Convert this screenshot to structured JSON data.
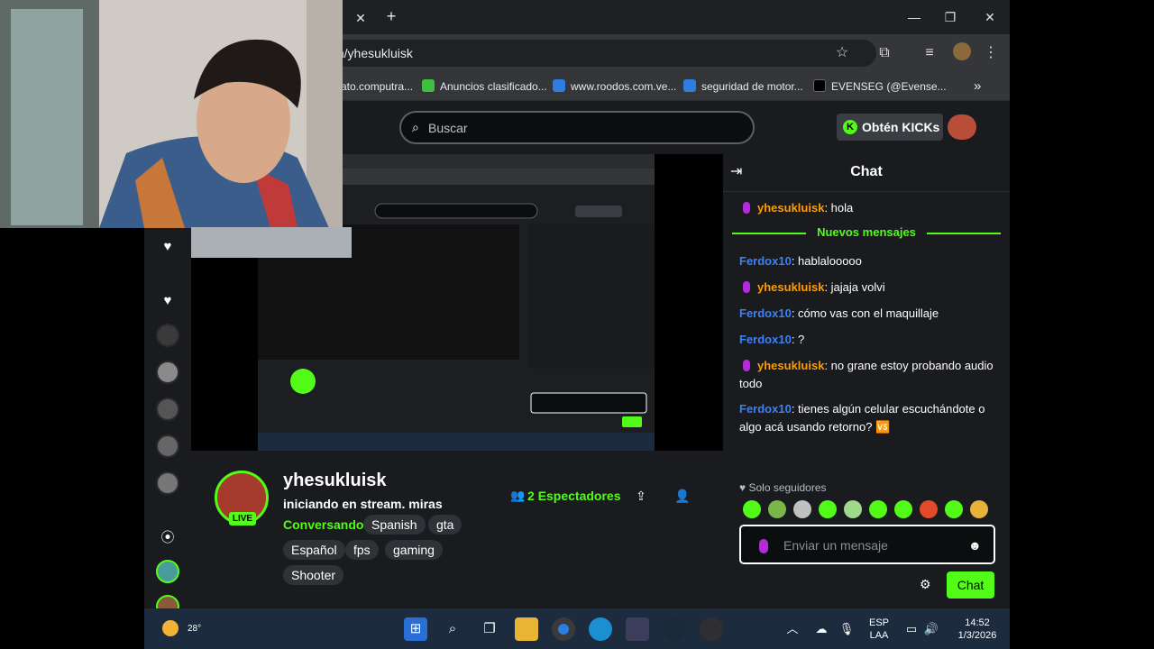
{
  "browser": {
    "url": "m/yhesukluisk",
    "bookmarks": [
      {
        "label": "ato.computra...",
        "color": "#4a4a4a"
      },
      {
        "label": "Anuncios clasificado...",
        "color": "#3fbf3f"
      },
      {
        "label": "www.roodos.com.ve...",
        "color": "#2f7de1"
      },
      {
        "label": "seguridad de motor...",
        "color": "#2f7de1"
      },
      {
        "label": "EVENSEG (@Evense...",
        "color": "#000000"
      }
    ]
  },
  "header": {
    "search_placeholder": "Buscar",
    "kicks_label": "Obtén KICKs"
  },
  "channel": {
    "name": "yhesukluisk",
    "title": "iniciando en stream. miras",
    "category": "Conversando",
    "live": "LIVE",
    "viewers_count": "2",
    "viewers_label": "Espectadores",
    "tags_row1": [
      "Spanish",
      "gta"
    ],
    "tags_row2": [
      "Español",
      "fps",
      "gaming"
    ],
    "tags_row3": [
      "Shooter"
    ]
  },
  "chat": {
    "title": "Chat",
    "new_messages": "Nuevos mensajes",
    "messages": [
      {
        "user": "yhesukluisk",
        "text": ": hola",
        "mod": true
      },
      {
        "user": "Ferdox10",
        "text": ": hablalooooo",
        "mod": false
      },
      {
        "user": "yhesukluisk",
        "text": ": jajaja volvi",
        "mod": true
      },
      {
        "user": "Ferdox10",
        "text": ": cómo vas con el maquillaje",
        "mod": false
      },
      {
        "user": "Ferdox10",
        "text": ": ?",
        "mod": false
      },
      {
        "user": "yhesukluisk",
        "text": ": no grane estoy probando audio todo",
        "mod": true
      },
      {
        "user": "Ferdox10",
        "text": ": tienes algún celular escuchándote o algo acá usando retorno? 🆚",
        "mod": false
      }
    ],
    "followers_only": "Solo seguidores",
    "input_placeholder": "Enviar un mensaje",
    "send_label": "Chat"
  },
  "taskbar": {
    "temp": "28°",
    "lang_top": "ESP",
    "lang_bottom": "LAA",
    "time": "14:52",
    "date": "1/3/2026"
  },
  "colors": {
    "kick_green": "#53fc18",
    "mod_orange": "#ff9d00",
    "user_blue": "#3b82f6"
  }
}
